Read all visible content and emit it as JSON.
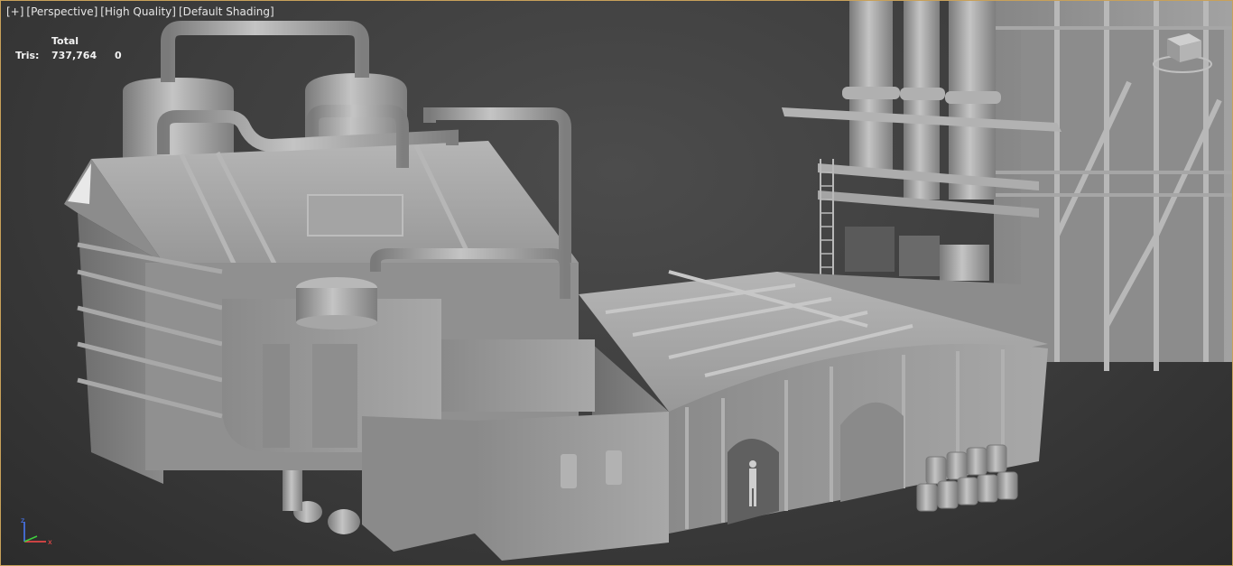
{
  "viewport": {
    "labels": [
      "[+]",
      "[Perspective]",
      "[High Quality]",
      "[Default Shading]"
    ],
    "stats": {
      "header": "Total",
      "row_label": "Tris:",
      "total_value": "737,764",
      "selected_value": "0"
    }
  },
  "gizmo": {
    "z": "z",
    "x": "x"
  },
  "colors": {
    "viewport_border": "#c8a15a",
    "model": "#9e9e9e",
    "background": "#3c3c3c"
  }
}
